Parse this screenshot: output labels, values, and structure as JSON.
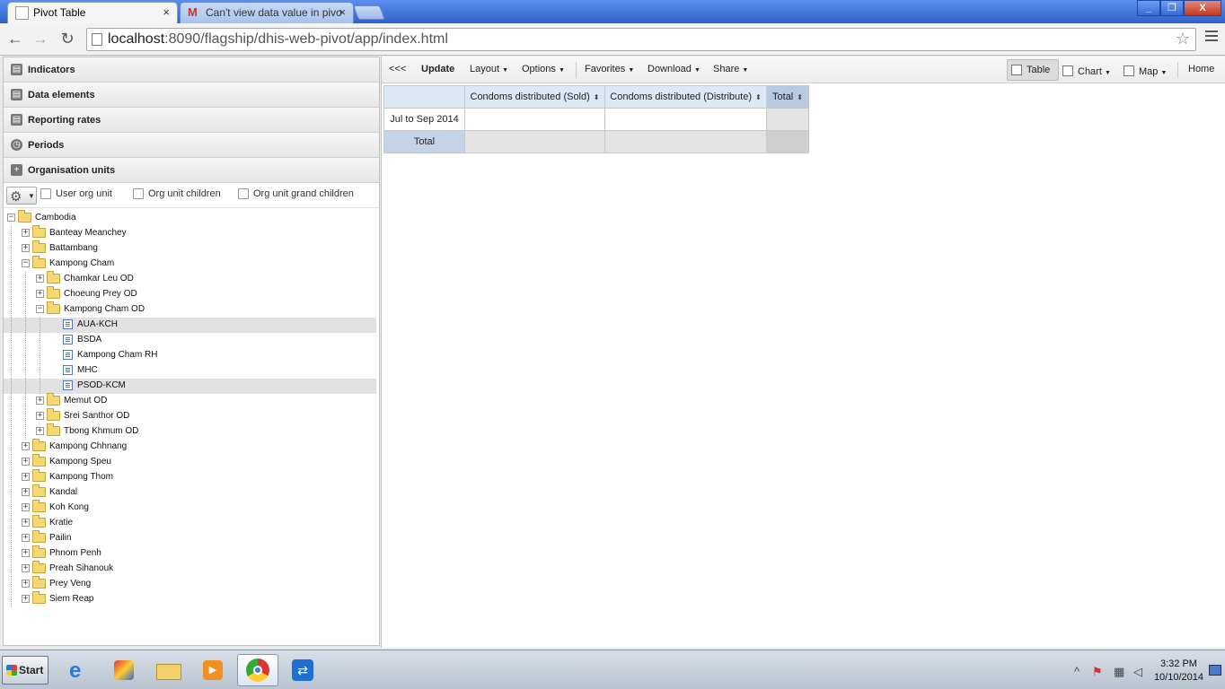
{
  "browser": {
    "tabs": [
      {
        "title": "Pivot Table",
        "active": true,
        "close": "×"
      },
      {
        "title": "Can't view data value in pivo",
        "active": false,
        "close": "×"
      }
    ],
    "url_host": "localhost",
    "url_rest": ":8090/flagship/dhis-web-pivot/app/index.html",
    "win_min": "_",
    "win_max": "❐",
    "win_close": "X"
  },
  "sidebar": {
    "accordion": [
      {
        "label": "Indicators",
        "icon": "book-icon"
      },
      {
        "label": "Data elements",
        "icon": "book-icon"
      },
      {
        "label": "Reporting rates",
        "icon": "book-icon"
      },
      {
        "label": "Periods",
        "icon": "clock-icon"
      },
      {
        "label": "Organisation units",
        "icon": "plus-icon"
      }
    ],
    "ou_options": {
      "user_org_unit": "User org unit",
      "org_unit_children": "Org unit children",
      "org_unit_grand_children": "Org unit grand children"
    },
    "tree": [
      {
        "label": "Cambodia",
        "level": 0,
        "type": "folder",
        "expander": "−"
      },
      {
        "label": "Banteay Meanchey",
        "level": 1,
        "type": "folder",
        "expander": "+"
      },
      {
        "label": "Battambang",
        "level": 1,
        "type": "folder",
        "expander": "+"
      },
      {
        "label": "Kampong Cham",
        "level": 1,
        "type": "folder",
        "expander": "−"
      },
      {
        "label": "Chamkar Leu OD",
        "level": 2,
        "type": "folder",
        "expander": "+"
      },
      {
        "label": "Choeung Prey OD",
        "level": 2,
        "type": "folder",
        "expander": "+"
      },
      {
        "label": "Kampong Cham OD",
        "level": 2,
        "type": "folder",
        "expander": "−"
      },
      {
        "label": "AUA-KCH",
        "level": 3,
        "type": "leaf",
        "selected": true
      },
      {
        "label": "BSDA",
        "level": 3,
        "type": "leaf"
      },
      {
        "label": "Kampong Cham RH",
        "level": 3,
        "type": "leaf"
      },
      {
        "label": "MHC",
        "level": 3,
        "type": "leaf"
      },
      {
        "label": "PSOD-KCM",
        "level": 3,
        "type": "leaf",
        "selected": true
      },
      {
        "label": "Memut OD",
        "level": 2,
        "type": "folder",
        "expander": "+"
      },
      {
        "label": "Srei Santhor OD",
        "level": 2,
        "type": "folder",
        "expander": "+"
      },
      {
        "label": "Tbong Khmum OD",
        "level": 2,
        "type": "folder",
        "expander": "+"
      },
      {
        "label": "Kampong Chhnang",
        "level": 1,
        "type": "folder",
        "expander": "+"
      },
      {
        "label": "Kampong Speu",
        "level": 1,
        "type": "folder",
        "expander": "+"
      },
      {
        "label": "Kampong Thom",
        "level": 1,
        "type": "folder",
        "expander": "+"
      },
      {
        "label": "Kandal",
        "level": 1,
        "type": "folder",
        "expander": "+"
      },
      {
        "label": "Koh Kong",
        "level": 1,
        "type": "folder",
        "expander": "+"
      },
      {
        "label": "Kratie",
        "level": 1,
        "type": "folder",
        "expander": "+"
      },
      {
        "label": "Pailin",
        "level": 1,
        "type": "folder",
        "expander": "+"
      },
      {
        "label": "Phnom Penh",
        "level": 1,
        "type": "folder",
        "expander": "+"
      },
      {
        "label": "Preah Sihanouk",
        "level": 1,
        "type": "folder",
        "expander": "+"
      },
      {
        "label": "Prey Veng",
        "level": 1,
        "type": "folder",
        "expander": "+"
      },
      {
        "label": "Siem Reap",
        "level": 1,
        "type": "folder",
        "expander": "+"
      }
    ]
  },
  "toolbar": {
    "collapse": "<<<",
    "update": "Update",
    "layout": "Layout",
    "options": "Options",
    "favorites": "Favorites",
    "download": "Download",
    "share": "Share",
    "table": "Table",
    "chart": "Chart",
    "map": "Map",
    "home": "Home"
  },
  "pivot": {
    "columns": [
      "Condoms distributed (Sold)",
      "Condoms distributed (Distribute)",
      "Total"
    ],
    "rows": [
      {
        "label": "Jul to Sep 2014",
        "values": [
          "",
          "",
          ""
        ]
      },
      {
        "label": "Total",
        "values": [
          "",
          "",
          ""
        ]
      }
    ],
    "sort_glyph": "⬍"
  },
  "taskbar": {
    "start": "Start",
    "time": "3:32 PM",
    "date": "10/10/2014"
  }
}
